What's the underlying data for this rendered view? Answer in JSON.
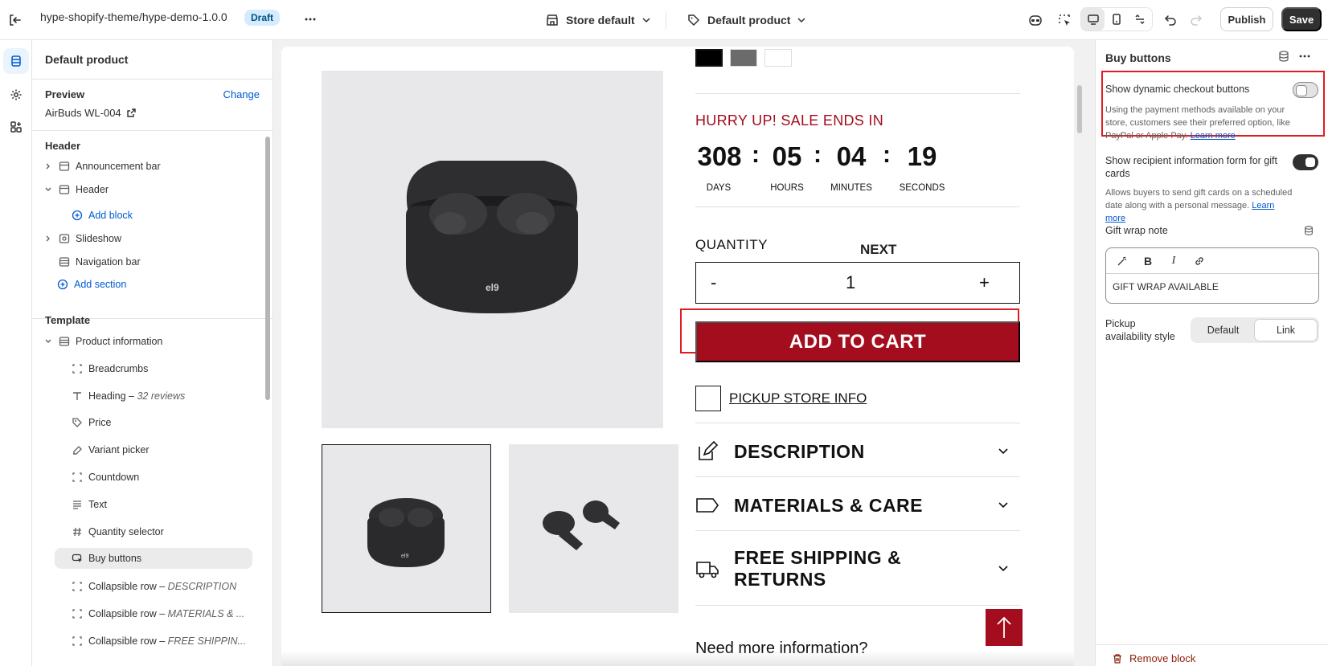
{
  "topbar": {
    "theme_name": "hype-shopify-theme/hype-demo-1.0.0",
    "status_badge": "Draft",
    "store_selector": "Store default",
    "template_selector": "Default product",
    "publish_label": "Publish",
    "save_label": "Save"
  },
  "left_panel": {
    "title": "Default product",
    "preview_label": "Preview",
    "change_label": "Change",
    "preview_product": "AirBuds WL-004",
    "header_section_title": "Header",
    "header_items": [
      {
        "label": "Announcement bar"
      },
      {
        "label": "Header"
      },
      {
        "label": "Add block"
      },
      {
        "label": "Slideshow"
      },
      {
        "label": "Navigation bar"
      },
      {
        "label": "Add section"
      }
    ],
    "template_section_title": "Template",
    "template_root": "Product information",
    "blocks": [
      {
        "label": "Breadcrumbs",
        "detail": ""
      },
      {
        "label": "Heading – ",
        "detail": "32 reviews"
      },
      {
        "label": "Price",
        "detail": ""
      },
      {
        "label": "Variant picker",
        "detail": ""
      },
      {
        "label": "Countdown",
        "detail": ""
      },
      {
        "label": "Text",
        "detail": ""
      },
      {
        "label": "Quantity selector",
        "detail": ""
      },
      {
        "label": "Buy buttons",
        "detail": ""
      },
      {
        "label": "Collapsible row – ",
        "detail": "DESCRIPTION"
      },
      {
        "label": "Collapsible row – ",
        "detail": "MATERIALS & ..."
      },
      {
        "label": "Collapsible row – ",
        "detail": "FREE SHIPPIN..."
      }
    ]
  },
  "preview": {
    "next_label": "NEXT",
    "hurry_text": "HURRY UP! SALE ENDS IN",
    "countdown": [
      {
        "value": "308",
        "unit": "DAYS"
      },
      {
        "value": "05",
        "unit": "HOURS"
      },
      {
        "value": "04",
        "unit": "MINUTES"
      },
      {
        "value": "19",
        "unit": "SECONDS"
      }
    ],
    "colon": ":",
    "quantity_label": "QUANTITY",
    "qty_minus": "-",
    "qty_value": "1",
    "qty_plus": "+",
    "add_to_cart": "ADD TO CART",
    "pickup_label": "PICKUP STORE INFO",
    "accordions": [
      {
        "title": "DESCRIPTION"
      },
      {
        "title": "MATERIALS & CARE"
      },
      {
        "title": "FREE SHIPPING & RETURNS"
      }
    ],
    "more_info": "Need more information?",
    "swatch_colors": [
      "#000000",
      "#6b6b6b",
      "#ffffff"
    ],
    "accent_color": "#a30d1d"
  },
  "right_panel": {
    "title": "Buy buttons",
    "dynamic_checkout_label": "Show dynamic checkout buttons",
    "dynamic_checkout_help": "Using the payment methods available on your store, customers see their preferred option, like PayPal or Apple Pay.",
    "learn_more": "Learn more",
    "dynamic_checkout_on": false,
    "recipient_form_label": "Show recipient information form for gift cards",
    "recipient_form_help": "Allows buyers to send gift cards on a scheduled date along with a personal message.",
    "recipient_form_on": true,
    "gift_wrap_label": "Gift wrap note",
    "gift_wrap_value": "GIFT WRAP AVAILABLE",
    "pickup_style_label": "Pickup availability style",
    "pickup_style_options": [
      "Default",
      "Link"
    ],
    "pickup_style_selected": "Link",
    "remove_block": "Remove block"
  }
}
